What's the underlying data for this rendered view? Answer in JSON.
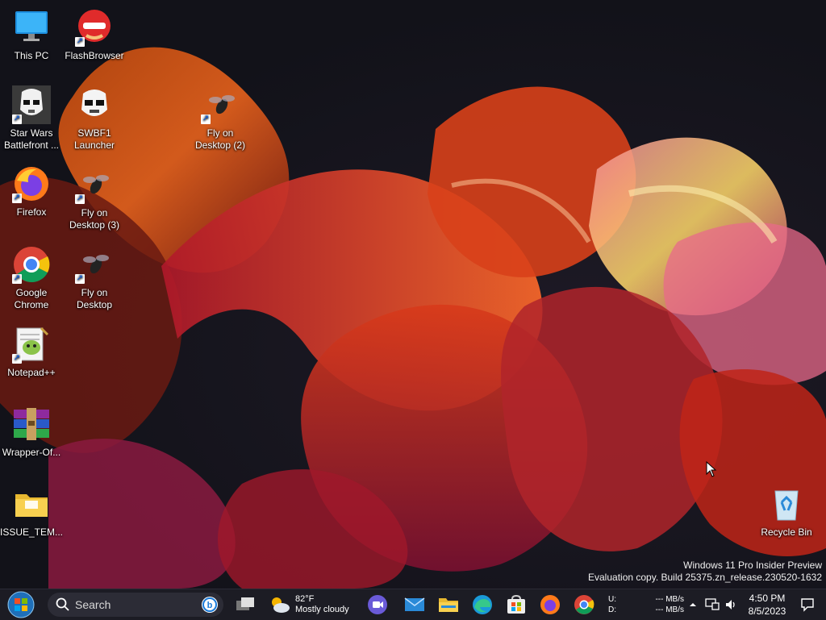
{
  "desktop": {
    "icons": [
      {
        "label": "This PC"
      },
      {
        "label": "FlashBrowser"
      },
      {
        "label": "Star Wars Battlefront ..."
      },
      {
        "label": "SWBF1 Launcher"
      },
      {
        "label": "Fly on Desktop (2)"
      },
      {
        "label": "Firefox"
      },
      {
        "label": "Fly on Desktop (3)"
      },
      {
        "label": "Google Chrome"
      },
      {
        "label": "Fly on Desktop"
      },
      {
        "label": "Notepad++"
      },
      {
        "label": "Wrapper-Of..."
      },
      {
        "label": "ISSUE_TEM..."
      },
      {
        "label": "Recycle Bin"
      }
    ]
  },
  "watermark": {
    "line1": "Windows 11 Pro Insider Preview",
    "line2": "Evaluation copy. Build 25375.zn_release.230520-1632"
  },
  "taskbar": {
    "search_label": "Search",
    "weather": {
      "temp": "82°F",
      "condition": "Mostly cloudy"
    },
    "network": {
      "up_label": "U:",
      "down_label": "D:",
      "up_value": "--- MB/s",
      "down_value": "--- MB/s"
    },
    "clock": {
      "time": "4:50 PM",
      "date": "8/5/2023"
    },
    "accent": "#1c1c24"
  }
}
